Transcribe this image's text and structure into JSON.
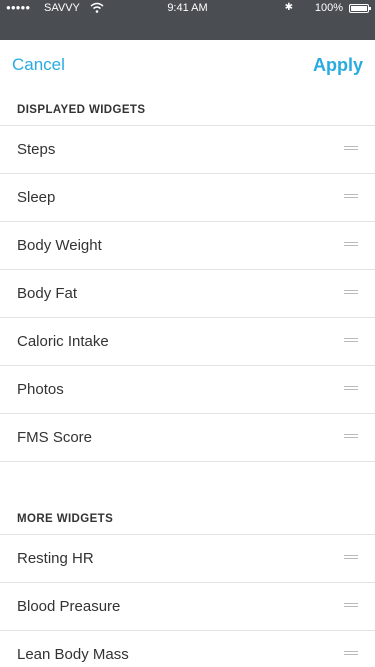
{
  "status_bar": {
    "carrier": "SAVVY",
    "time": "9:41 AM",
    "battery_percent": "100%",
    "battery_level": 1.0
  },
  "nav": {
    "cancel_label": "Cancel",
    "apply_label": "Apply"
  },
  "sections": [
    {
      "title": "DISPLAYED WIDGETS",
      "items": [
        {
          "label": "Steps"
        },
        {
          "label": "Sleep"
        },
        {
          "label": "Body Weight"
        },
        {
          "label": "Body Fat"
        },
        {
          "label": "Caloric Intake"
        },
        {
          "label": "Photos"
        },
        {
          "label": "FMS Score"
        }
      ]
    },
    {
      "title": "MORE WIDGETS",
      "items": [
        {
          "label": "Resting HR"
        },
        {
          "label": "Blood Preasure"
        },
        {
          "label": "Lean Body Mass"
        }
      ]
    }
  ],
  "colors": {
    "accent": "#29abe2",
    "divider": "#e3e3e3",
    "status_bar_bg": "#4a4d52"
  }
}
